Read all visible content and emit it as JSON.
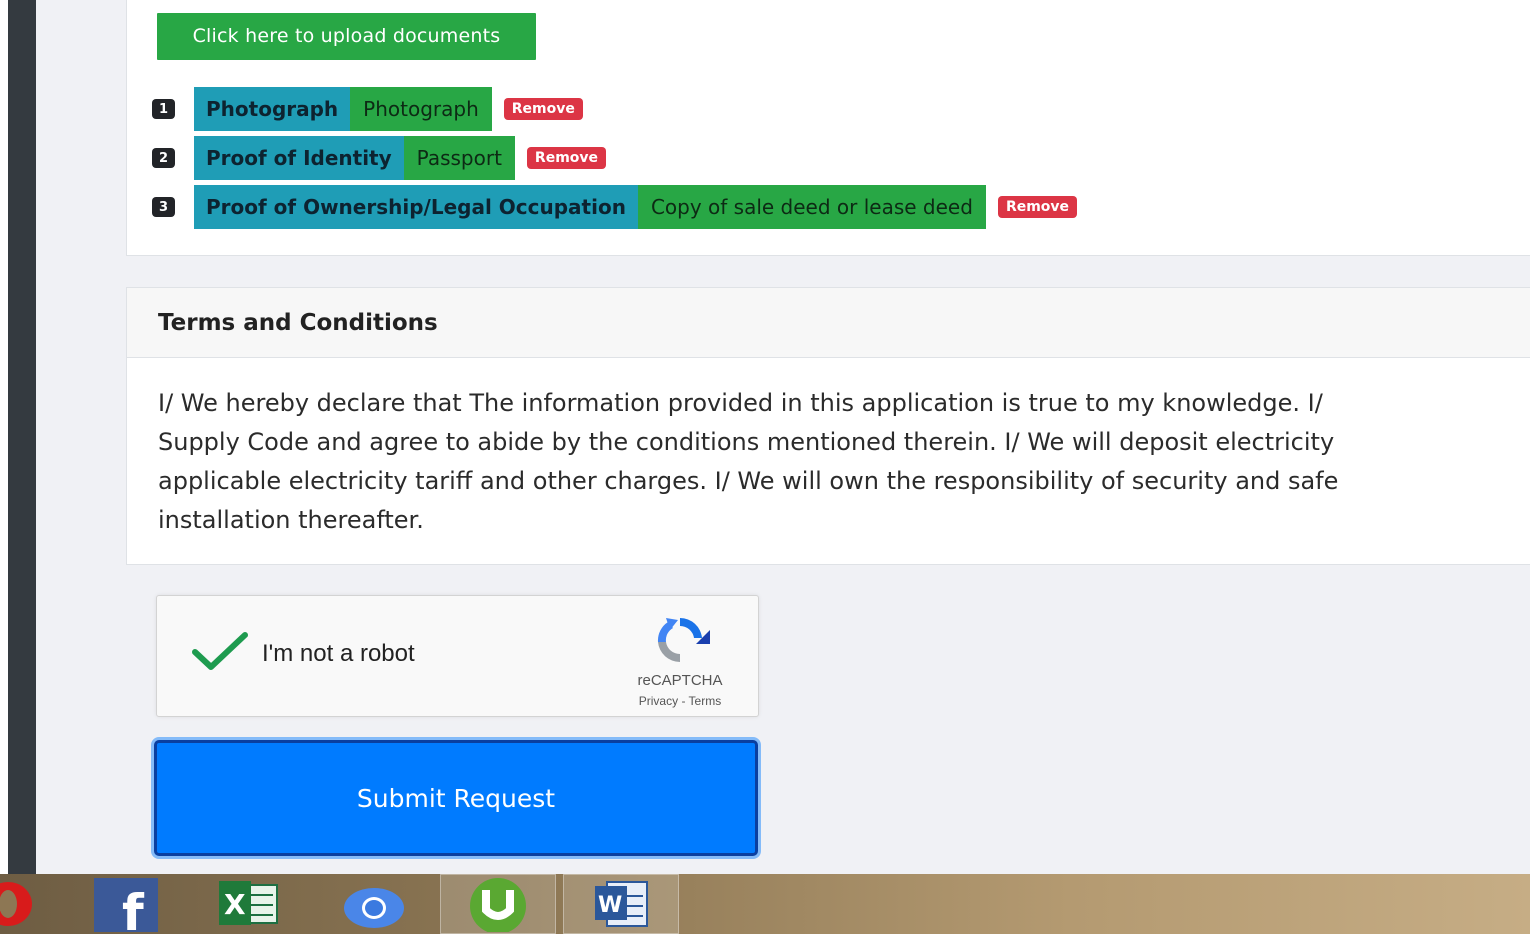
{
  "upload": {
    "button_label": "Click here to upload documents"
  },
  "documents": [
    {
      "number": "1",
      "type": "Photograph",
      "name": "Photograph",
      "remove_label": "Remove"
    },
    {
      "number": "2",
      "type": "Proof of Identity",
      "name": "Passport",
      "remove_label": "Remove"
    },
    {
      "number": "3",
      "type": "Proof of Ownership/Legal Occupation",
      "name": "Copy of sale deed or lease deed",
      "remove_label": "Remove"
    }
  ],
  "terms": {
    "title": "Terms and Conditions",
    "lines": [
      "I/ We hereby declare that The information provided in this application is true to my knowledge. I/",
      "Supply Code and agree to abide by the conditions mentioned therein. I/ We will deposit electricity",
      "applicable electricity tariff and other charges. I/ We will own the responsibility of security and safe",
      "installation thereafter."
    ]
  },
  "captcha": {
    "label": "I'm not a robot",
    "brand": "reCAPTCHA",
    "links": "Privacy - Terms",
    "checked": true
  },
  "submit": {
    "label": "Submit Request"
  },
  "taskbar": {
    "apps": [
      "opera-icon",
      "facebook-icon",
      "excel-icon",
      "chrome-icon",
      "utorrent-icon",
      "word-icon"
    ]
  },
  "colors": {
    "green": "#28a745",
    "teal": "#1f9db6",
    "red": "#dc3545",
    "blue": "#007bff"
  }
}
